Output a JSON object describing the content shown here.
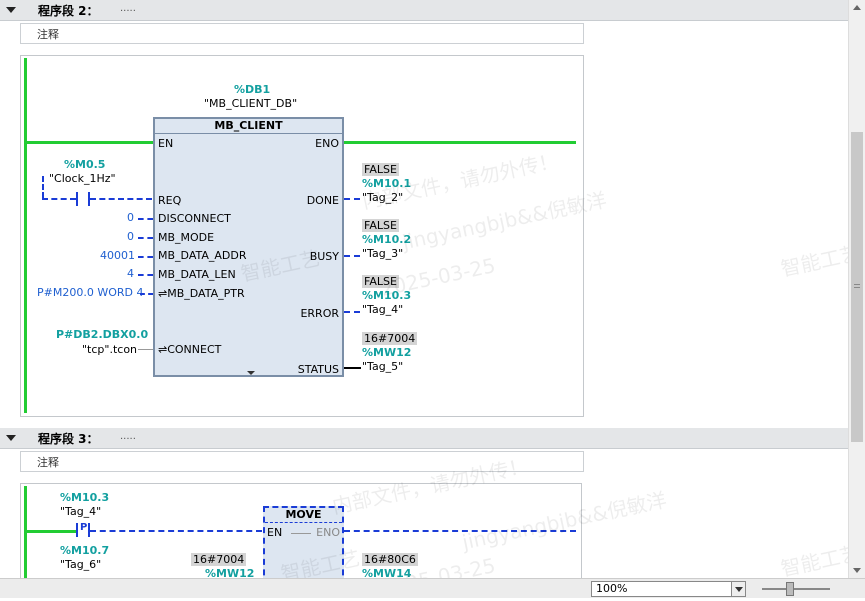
{
  "segments": [
    {
      "title": "程序段 2：",
      "dots": ".....",
      "comment": "注释"
    },
    {
      "title": "程序段 3：",
      "dots": ".....",
      "comment": "注释"
    }
  ],
  "fb": {
    "db_address": "%DB1",
    "db_name": "\"MB_CLIENT_DB\"",
    "name": "MB_CLIENT",
    "inputs": {
      "en": "EN",
      "req": "REQ",
      "disconnect": "DISCONNECT",
      "mb_mode": "MB_MODE",
      "mb_data_addr": "MB_DATA_ADDR",
      "mb_data_len": "MB_DATA_LEN",
      "mb_data_ptr": "⇌MB_DATA_PTR",
      "connect": "⇌CONNECT"
    },
    "outputs": {
      "eno": "ENO",
      "done": "DONE",
      "busy": "BUSY",
      "error": "ERROR",
      "status": "STATUS"
    }
  },
  "req_contact": {
    "address": "%M0.5",
    "tag": "\"Clock_1Hz\""
  },
  "input_values": {
    "disconnect": "0",
    "mb_mode": "0",
    "mb_data_addr": "40001",
    "mb_data_len": "4",
    "mb_data_ptr": "P#M200.0 WORD 4",
    "connect_address": "P#DB2.DBX0.0",
    "connect_tag": "\"tcp\".tcon"
  },
  "outputs": {
    "done": {
      "value": "FALSE",
      "address": "%M10.1",
      "tag": "\"Tag_2\""
    },
    "busy": {
      "value": "FALSE",
      "address": "%M10.2",
      "tag": "\"Tag_3\""
    },
    "error": {
      "value": "FALSE",
      "address": "%M10.3",
      "tag": "\"Tag_4\""
    },
    "status": {
      "value": "16#7004",
      "address": "%MW12",
      "tag": "\"Tag_5\""
    }
  },
  "segment3": {
    "contact1": {
      "address": "%M10.3",
      "tag": "\"Tag_4\"",
      "symbol": "P"
    },
    "contact2": {
      "address": "%M10.7",
      "tag": "\"Tag_6\""
    },
    "move": {
      "name": "MOVE",
      "en": "EN",
      "eno": "ENO"
    },
    "in_value": "16#7004",
    "in_address": "%MW12",
    "out_value": "16#80C6",
    "out_address": "%MW14"
  },
  "zoom": {
    "value": "100%"
  },
  "watermarks": [
    "内部文件，请勿外传！",
    "jingyangbjb&&倪敏洋",
    "智能工艺",
    "2025-03-25"
  ],
  "colors": {
    "rail": "#22cc33",
    "signal": "#1a3cd6",
    "address": "#13a0a0",
    "fb_fill": "#dde6f1"
  }
}
